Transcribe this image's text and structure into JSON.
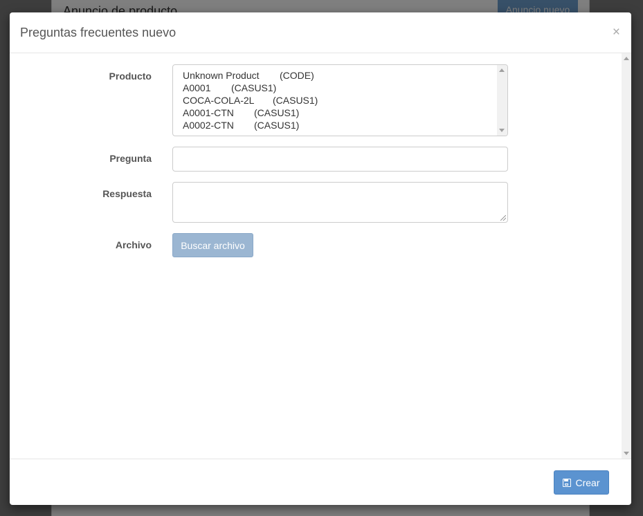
{
  "background_page": {
    "title": "Anuncio de producto",
    "new_button_label": "Anuncio nuevo"
  },
  "modal": {
    "title": "Preguntas frecuentes nuevo",
    "close_label": "×"
  },
  "form": {
    "product_label": "Producto",
    "product_options": [
      {
        "code": "Unknown Product",
        "category": "(CODE)"
      },
      {
        "code": "A0001",
        "category": "(CASUS1)"
      },
      {
        "code": "COCA-COLA-2L",
        "category": "(CASUS1)"
      },
      {
        "code": "A0001-CTN",
        "category": "(CASUS1)"
      },
      {
        "code": "A0002-CTN",
        "category": "(CASUS1)"
      }
    ],
    "question_label": "Pregunta",
    "question_value": "",
    "answer_label": "Respuesta",
    "answer_value": "",
    "file_label": "Archivo",
    "file_button_label": "Buscar archivo"
  },
  "footer": {
    "create_label": "Crear",
    "create_icon": "save-icon"
  },
  "colors": {
    "primary": "#5b93d0",
    "primary_disabled": "#9bb6d2"
  }
}
